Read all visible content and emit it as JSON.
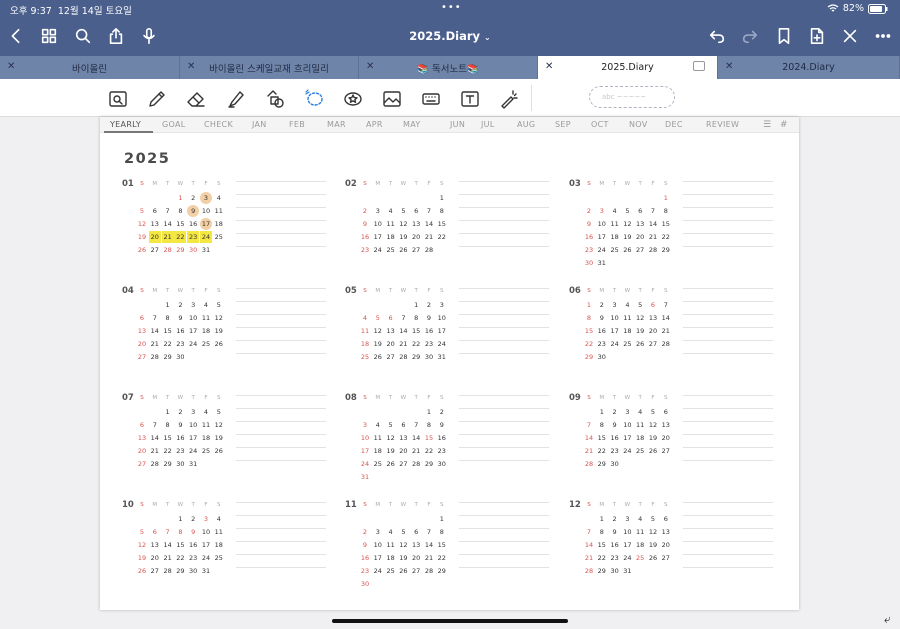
{
  "status": {
    "time": "오후 9:37",
    "date": "12월 14일 토요일",
    "battery": "82%"
  },
  "header": {
    "title": "2025.Diary",
    "dropdown_icon": "chevron-down-icon"
  },
  "tabs": [
    {
      "label": "바이올린",
      "active": false
    },
    {
      "label": "바이올린 스케일교재 흐리밀리",
      "active": false
    },
    {
      "label": "📚 독서노트📚",
      "active": false
    },
    {
      "label": "2025.Diary",
      "active": true
    },
    {
      "label": "2024.Diary",
      "active": false
    }
  ],
  "shape_tool": {
    "label": "abc"
  },
  "page_tabs": [
    "YEARLY",
    "GOAL",
    "CHECK",
    "JAN",
    "FEB",
    "MAR",
    "APR",
    "MAY",
    "JUN",
    "JUL",
    "AUG",
    "SEP",
    "OCT",
    "NOV",
    "DEC",
    "REVIEW"
  ],
  "year": "2025",
  "weekday_letters": [
    "S",
    "M",
    "T",
    "W",
    "T",
    "F",
    "S"
  ],
  "months": [
    {
      "num": "01",
      "start": 3,
      "days": 31,
      "holidays": [
        1,
        28,
        29,
        30
      ],
      "circled": [
        3,
        9,
        17
      ],
      "highlight": [
        20,
        21,
        22,
        23,
        24
      ]
    },
    {
      "num": "02",
      "start": 6,
      "days": 28,
      "holidays": [],
      "circled": [],
      "highlight": []
    },
    {
      "num": "03",
      "start": 6,
      "days": 31,
      "holidays": [
        1,
        3
      ],
      "circled": [],
      "highlight": []
    },
    {
      "num": "04",
      "start": 2,
      "days": 30,
      "holidays": [],
      "circled": [],
      "highlight": []
    },
    {
      "num": "05",
      "start": 4,
      "days": 31,
      "holidays": [
        5,
        6
      ],
      "circled": [],
      "highlight": []
    },
    {
      "num": "06",
      "start": 0,
      "days": 30,
      "holidays": [
        6
      ],
      "circled": [],
      "highlight": []
    },
    {
      "num": "07",
      "start": 2,
      "days": 31,
      "holidays": [],
      "circled": [],
      "highlight": []
    },
    {
      "num": "08",
      "start": 5,
      "days": 31,
      "holidays": [
        15
      ],
      "circled": [],
      "highlight": []
    },
    {
      "num": "09",
      "start": 1,
      "days": 30,
      "holidays": [],
      "circled": [],
      "highlight": []
    },
    {
      "num": "10",
      "start": 3,
      "days": 31,
      "holidays": [
        3,
        6,
        7,
        8,
        9
      ],
      "circled": [],
      "highlight": []
    },
    {
      "num": "11",
      "start": 6,
      "days": 30,
      "holidays": [],
      "circled": [],
      "highlight": []
    },
    {
      "num": "12",
      "start": 1,
      "days": 31,
      "holidays": [
        25
      ],
      "circled": [],
      "highlight": []
    }
  ],
  "colors": {
    "topbar": "#4a5f8c",
    "tabbar": "#6f84a9",
    "holiday": "#d9534f",
    "circle": "#f2cfa4",
    "highlight": "#f4e742"
  }
}
